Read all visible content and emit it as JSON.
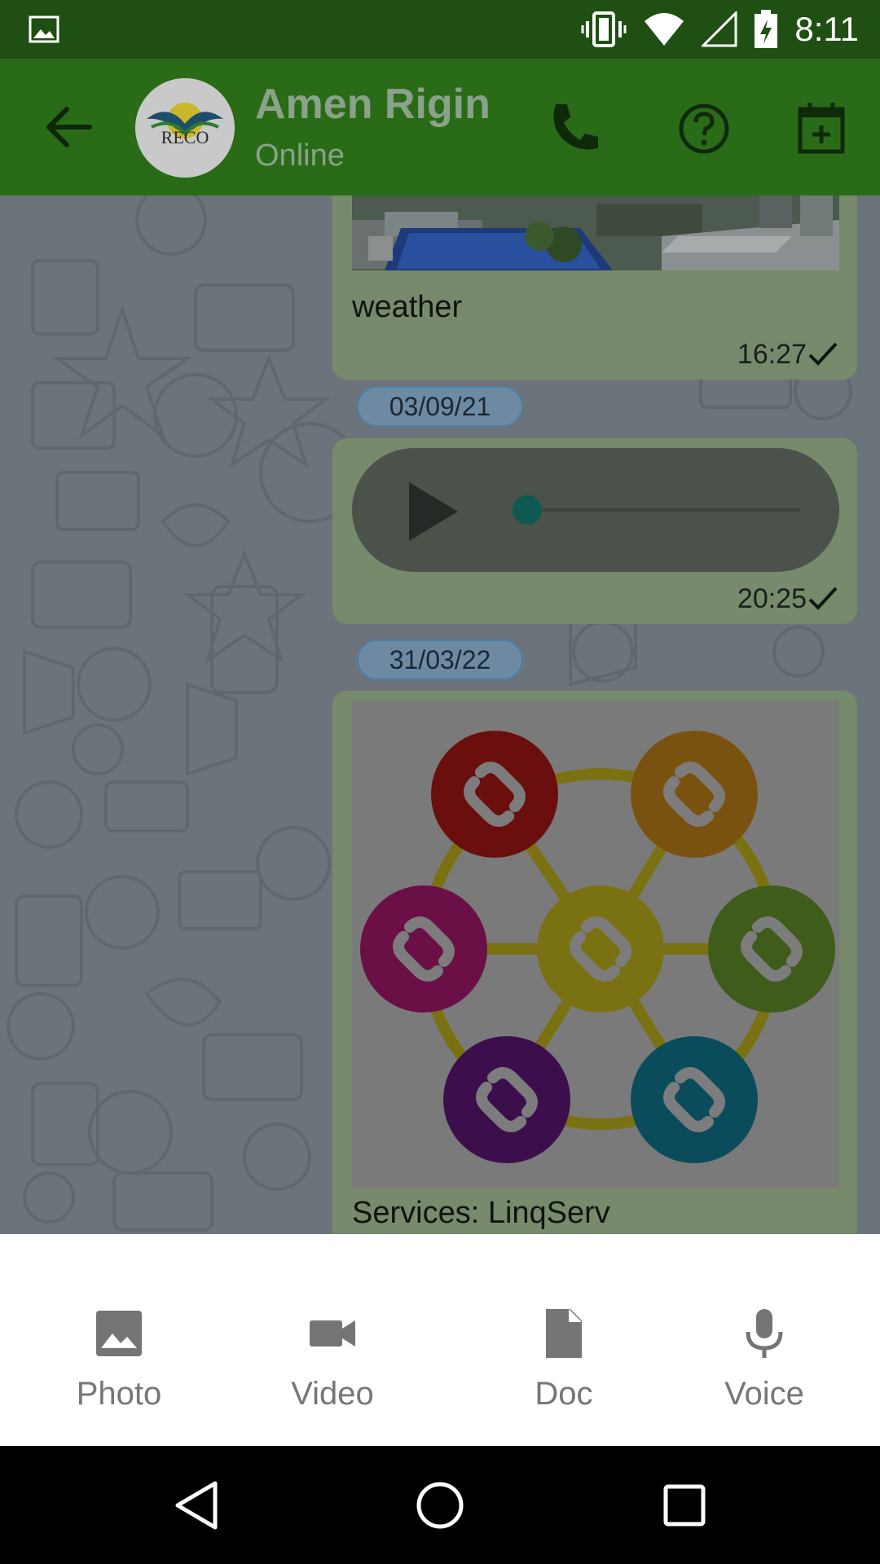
{
  "status_bar": {
    "time": "8:11",
    "icons": [
      "image-icon",
      "vibrate-icon",
      "wifi-icon",
      "signal-icon",
      "battery-charging-icon"
    ]
  },
  "header": {
    "contact_name": "Amen Rigin",
    "contact_status": "Online",
    "avatar_text": "RECO",
    "actions": [
      "phone-icon",
      "help-icon",
      "calendar-add-icon"
    ]
  },
  "messages": [
    {
      "type": "image",
      "caption": "weather",
      "time": "16:27"
    },
    {
      "type": "date",
      "label": "03/09/21"
    },
    {
      "type": "audio",
      "time": "20:25",
      "progress": 0.0
    },
    {
      "type": "date",
      "label": "31/03/22"
    },
    {
      "type": "image",
      "caption": "Services: LinqServ"
    }
  ],
  "attachment_sheet": {
    "options": [
      {
        "label": "Photo",
        "icon": "photo-icon"
      },
      {
        "label": "Video",
        "icon": "video-icon"
      },
      {
        "label": "Doc",
        "icon": "doc-icon"
      },
      {
        "label": "Voice",
        "icon": "mic-icon"
      }
    ]
  },
  "nav_bar": {
    "buttons": [
      "back-icon",
      "home-icon",
      "recents-icon"
    ]
  },
  "colors": {
    "status_bar": "#1f4f12",
    "app_bar": "#2a6b18",
    "link_red": "#c41414",
    "link_orange": "#e8960a",
    "link_magenta": "#c4167a",
    "link_green": "#6da82a",
    "link_purple": "#6a1a8a",
    "link_teal": "#0a8aa8",
    "link_yellow": "#e0cc14"
  }
}
